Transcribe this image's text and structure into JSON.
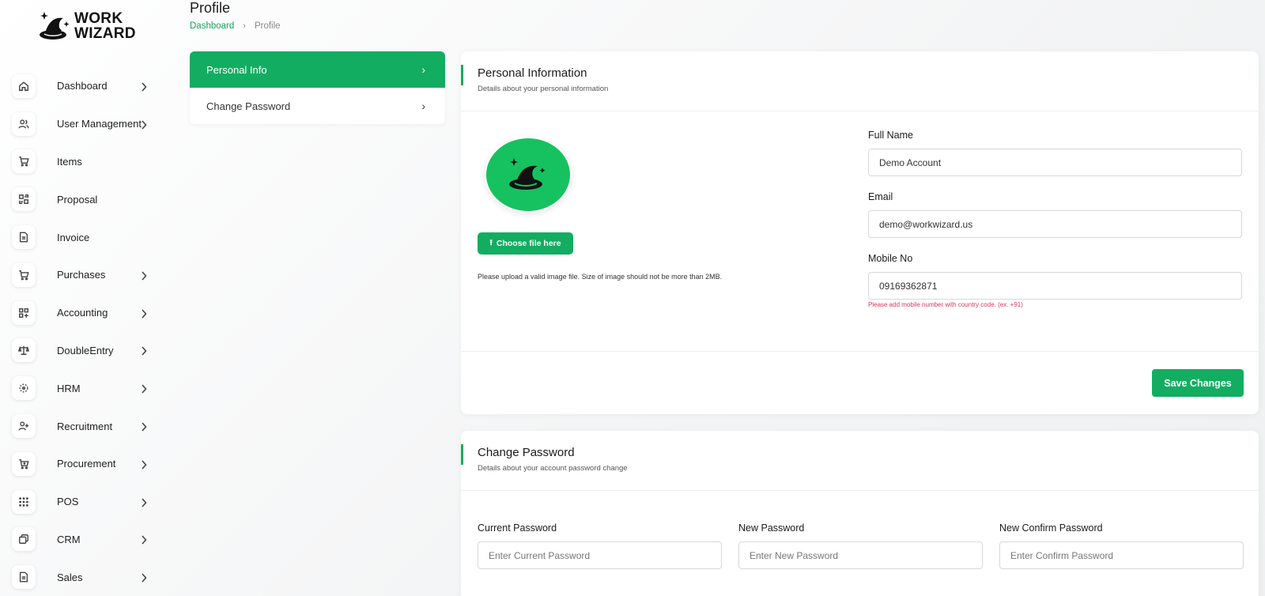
{
  "brand": {
    "line1": "WORK",
    "line2": "WIZARD"
  },
  "sidebar": {
    "items": [
      {
        "label": "Dashboard",
        "icon": "home-icon",
        "chevron": true
      },
      {
        "label": "User Management",
        "icon": "users-icon",
        "chevron": true
      },
      {
        "label": "Items",
        "icon": "cart-icon",
        "chevron": false
      },
      {
        "label": "Proposal",
        "icon": "proposal-icon",
        "chevron": false
      },
      {
        "label": "Invoice",
        "icon": "file-icon",
        "chevron": false
      },
      {
        "label": "Purchases",
        "icon": "cart-icon",
        "chevron": true
      },
      {
        "label": "Accounting",
        "icon": "grid-plus-icon",
        "chevron": true
      },
      {
        "label": "DoubleEntry",
        "icon": "scale-icon",
        "chevron": true
      },
      {
        "label": "HRM",
        "icon": "target-icon",
        "chevron": true
      },
      {
        "label": "Recruitment",
        "icon": "user-plus-icon",
        "chevron": true
      },
      {
        "label": "Procurement",
        "icon": "cart-add-icon",
        "chevron": true
      },
      {
        "label": "POS",
        "icon": "dots-grid-icon",
        "chevron": true
      },
      {
        "label": "CRM",
        "icon": "layers-icon",
        "chevron": true
      },
      {
        "label": "Sales",
        "icon": "file-icon",
        "chevron": true
      }
    ]
  },
  "header": {
    "title": "Profile",
    "breadcrumb": {
      "link": "Dashboard",
      "current": "Profile"
    }
  },
  "tabs": [
    {
      "label": "Personal Info",
      "active": true
    },
    {
      "label": "Change Password",
      "active": false
    }
  ],
  "personal": {
    "title": "Personal Information",
    "subtitle": "Details about your personal information",
    "choose_file": "Choose file here",
    "upload_note": "Please upload a valid image file. Size of image should not be more than 2MB.",
    "full_name_label": "Full Name",
    "full_name_value": "Demo Account",
    "email_label": "Email",
    "email_value": "demo@workwizard.us",
    "mobile_label": "Mobile No",
    "mobile_value": "09169362871",
    "mobile_hint": "Please add mobile number with country code. (ex. +91)",
    "save_label": "Save Changes"
  },
  "password": {
    "title": "Change Password",
    "subtitle": "Details about your account password change",
    "current_label": "Current Password",
    "current_placeholder": "Enter Current Password",
    "new_label": "New Password",
    "new_placeholder": "Enter New Password",
    "confirm_label": "New Confirm Password",
    "confirm_placeholder": "Enter Confirm Password"
  },
  "colors": {
    "accent": "#12ad61",
    "avatar_bg": "#16c25f",
    "hint": "#d63a5a"
  }
}
